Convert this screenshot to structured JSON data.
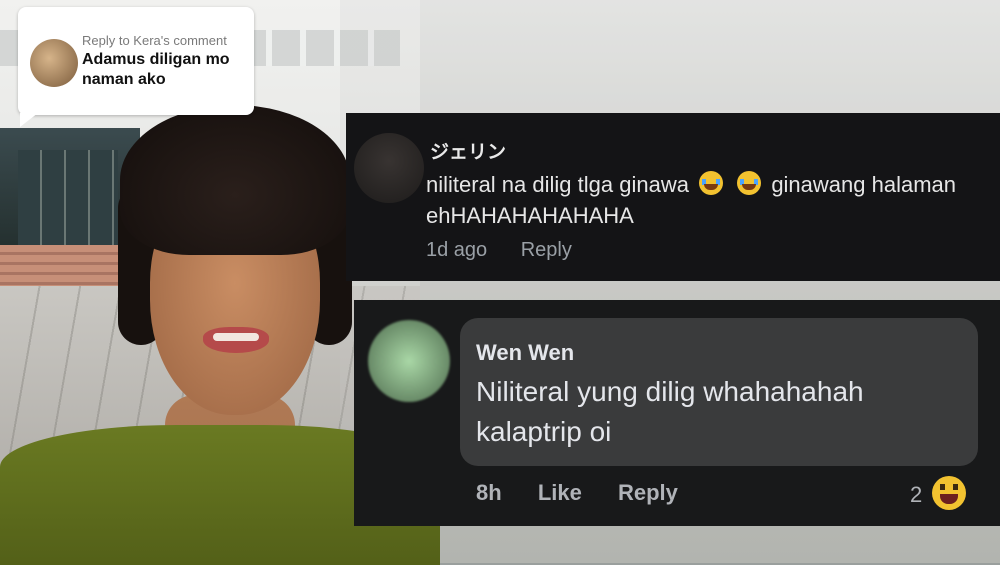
{
  "reply_card": {
    "kicker": "Reply to Kera's comment",
    "text": "Adamus diligan mo naman ako"
  },
  "comment_1": {
    "name": "ジェリン",
    "text_a": "niliteral na dilig tlga ginawa",
    "text_b": "ginawang halaman",
    "text_c": "ehHAHAHAHAHAHA",
    "time": "1d ago",
    "reply": "Reply"
  },
  "comment_2": {
    "name": "Wen Wen",
    "text": "Niliteral yung dilig whahahahah kalaptrip oi",
    "time": "8h",
    "like": "Like",
    "reply": "Reply",
    "reaction_count": "2"
  },
  "icons": {
    "crying": "loudly-crying-face-icon",
    "laugh": "laughing-face-icon"
  }
}
